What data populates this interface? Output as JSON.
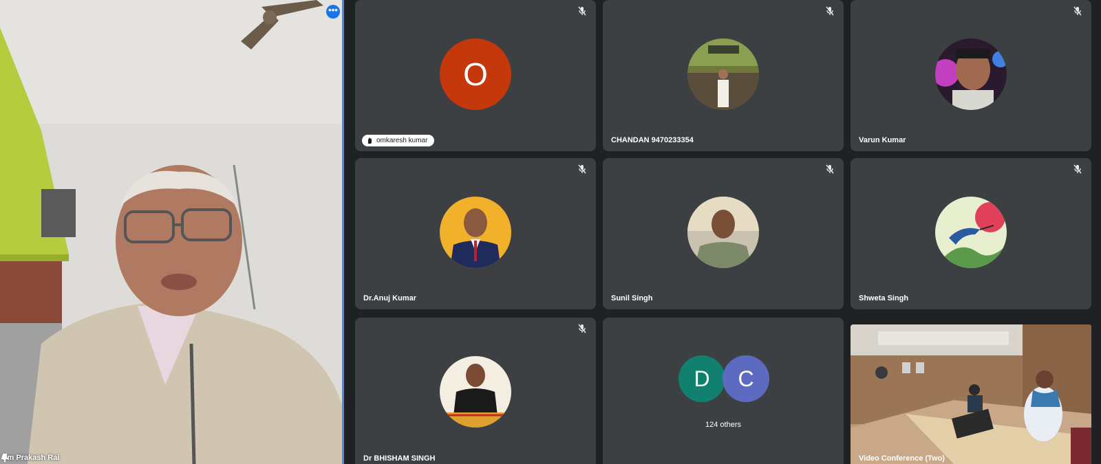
{
  "presenter": {
    "name": "Om Prakash Rai",
    "more_icon": "more-options-icon",
    "pin_icon": "pin-icon"
  },
  "tiles": [
    {
      "name": "omkaresh kumar",
      "avatar_letter": "O",
      "avatar_color": "#c5380b",
      "muted": true,
      "style": "chip"
    },
    {
      "name": "CHANDAN 9470233354",
      "muted": true
    },
    {
      "name": "Varun Kumar",
      "muted": true
    },
    {
      "name": "Dr.Anuj Kumar",
      "muted": true
    },
    {
      "name": "Sunil Singh",
      "muted": true
    },
    {
      "name": "Shweta Singh",
      "muted": true
    },
    {
      "name": "Dr BHISHAM SINGH",
      "muted": true
    }
  ],
  "others": {
    "avatars": [
      {
        "letter": "D",
        "color": "#12806f"
      },
      {
        "letter": "C",
        "color": "#5c6bc0"
      }
    ],
    "count_label": "124 others"
  },
  "room": {
    "name": "Video Conference (Two)"
  },
  "colors": {
    "background": "#202124",
    "tile": "#3c4043",
    "active_border": "#4f86e8"
  }
}
